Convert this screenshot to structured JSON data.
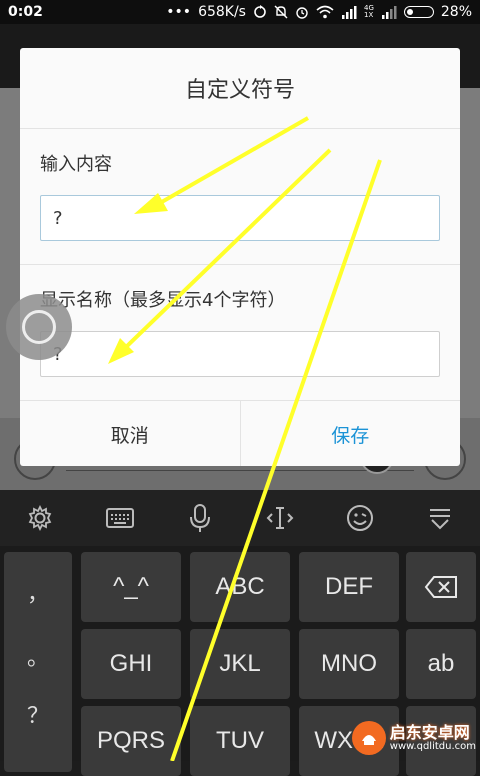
{
  "status_bar": {
    "time": "0:02",
    "dots": "•••",
    "speed": "658K/s",
    "network_label_top": "4G",
    "network_label_bottom": "1X",
    "battery": "28%",
    "battery_level": 0.28
  },
  "dialog": {
    "title": "自定义符号",
    "field1": {
      "label": "输入内容",
      "value": "?"
    },
    "field2": {
      "label": "显示名称（最多显示4个字符）",
      "value": "?"
    },
    "cancel_label": "取消",
    "save_label": "保存"
  },
  "keyboard": {
    "toolbar_icons": [
      "gear-icon",
      "keyboard-icon",
      "microphone-icon",
      "cursor-icon",
      "emoji-icon",
      "collapse-icon"
    ],
    "side_keys": [
      "，",
      "。",
      "？"
    ],
    "row1": [
      "^_^",
      "ABC",
      "DEF"
    ],
    "row2": [
      "GHI",
      "JKL",
      "MNO",
      "ab"
    ],
    "row3": [
      "PQRS",
      "TUV",
      "WXYZ"
    ]
  },
  "watermark": {
    "name": "启东安卓网",
    "url": "www.qdlitdu.com"
  },
  "colors": {
    "accent": "#1b93d6",
    "annotation": "#ffff2a",
    "watermark": "#f26a21"
  }
}
